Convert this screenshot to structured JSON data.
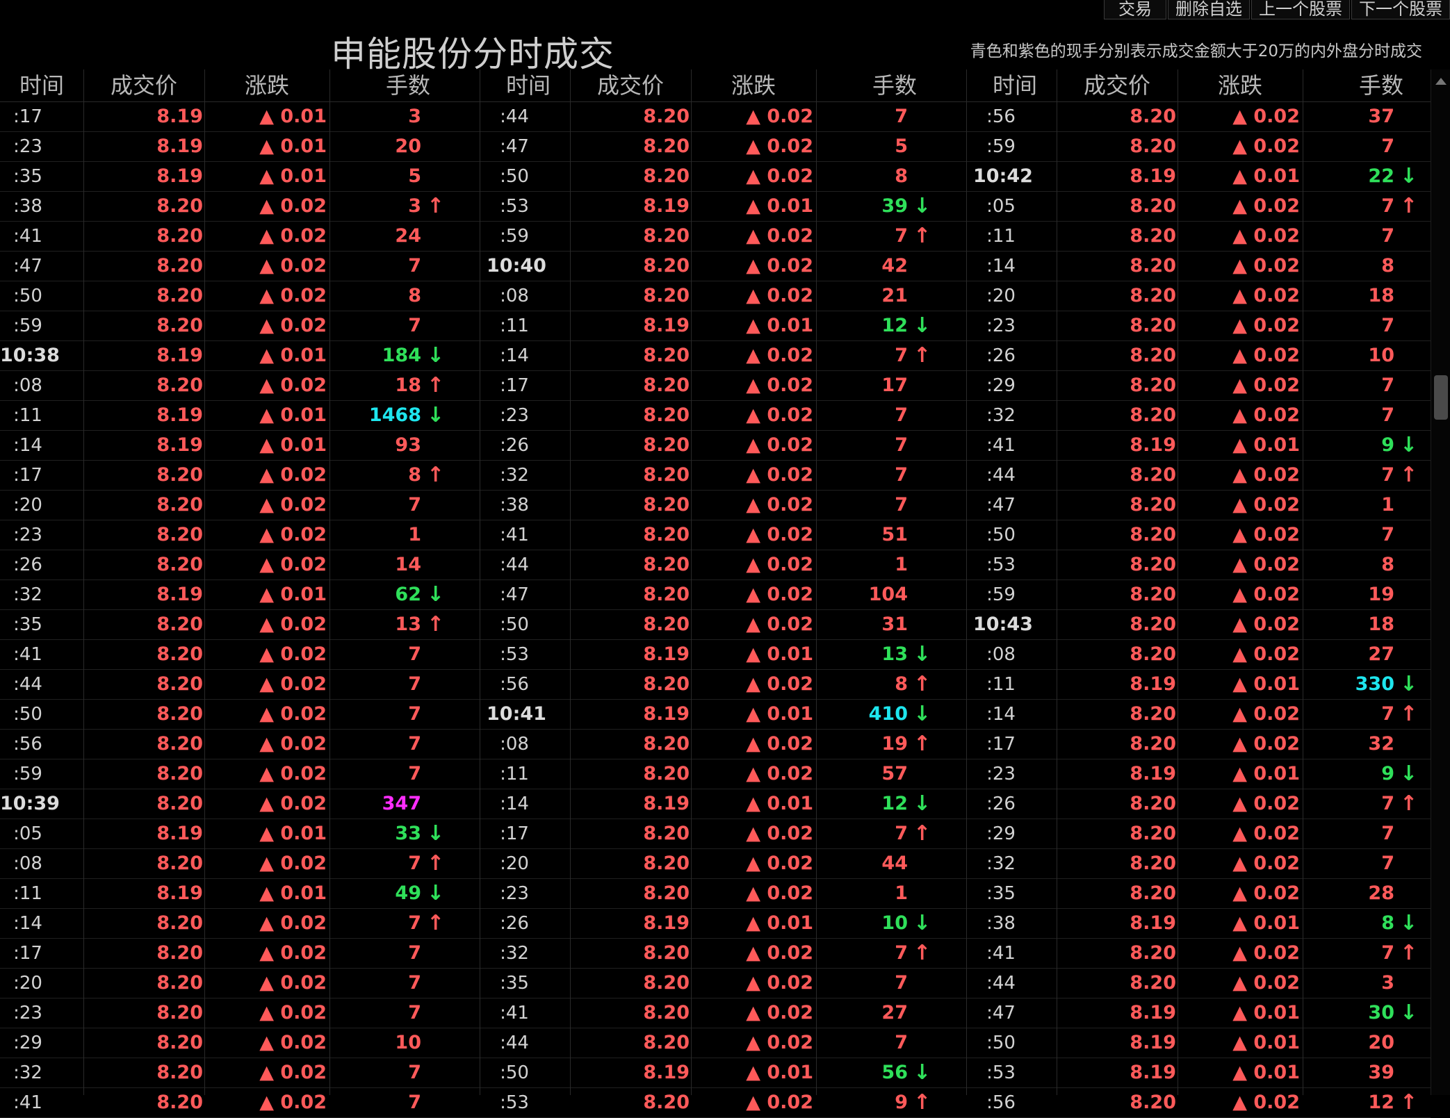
{
  "toolbar": {
    "buttons": [
      "交易",
      "删除自选",
      "上一个股票",
      "下一个股票"
    ]
  },
  "title": "申能股份分时成交",
  "note": "青色和紫色的现手分别表示成交金额大于20万的内外盘分时成交",
  "headers": [
    "时间",
    "成交价",
    "涨跌",
    "手数"
  ],
  "colors": {
    "up": "#ff5a5a",
    "down": "#2fe05a",
    "big_volume": "#1ee6ee",
    "big_volume_outer": "#ff2dff",
    "background": "#000000"
  },
  "columns": [
    {
      "rows": [
        {
          "time": ":17",
          "price": "8.19",
          "change": "▲ 0.01",
          "volume": "3",
          "arrow": ""
        },
        {
          "time": ":23",
          "price": "8.19",
          "change": "▲ 0.01",
          "volume": "20",
          "arrow": ""
        },
        {
          "time": ":35",
          "price": "8.19",
          "change": "▲ 0.01",
          "volume": "5",
          "arrow": ""
        },
        {
          "time": ":38",
          "price": "8.20",
          "change": "▲ 0.02",
          "volume": "3",
          "arrow": "up"
        },
        {
          "time": ":41",
          "price": "8.20",
          "change": "▲ 0.02",
          "volume": "24",
          "arrow": ""
        },
        {
          "time": ":47",
          "price": "8.20",
          "change": "▲ 0.02",
          "volume": "7",
          "arrow": ""
        },
        {
          "time": ":50",
          "price": "8.20",
          "change": "▲ 0.02",
          "volume": "8",
          "arrow": ""
        },
        {
          "time": ":59",
          "price": "8.20",
          "change": "▲ 0.02",
          "volume": "7",
          "arrow": ""
        },
        {
          "time": "10:38",
          "price": "8.19",
          "change": "▲ 0.01",
          "volume": "184",
          "arrow": "down"
        },
        {
          "time": ":08",
          "price": "8.20",
          "change": "▲ 0.02",
          "volume": "18",
          "arrow": "up"
        },
        {
          "time": ":11",
          "price": "8.19",
          "change": "▲ 0.01",
          "volume": "1468",
          "arrow": "down",
          "big": "cyan"
        },
        {
          "time": ":14",
          "price": "8.19",
          "change": "▲ 0.01",
          "volume": "93",
          "arrow": ""
        },
        {
          "time": ":17",
          "price": "8.20",
          "change": "▲ 0.02",
          "volume": "8",
          "arrow": "up"
        },
        {
          "time": ":20",
          "price": "8.20",
          "change": "▲ 0.02",
          "volume": "7",
          "arrow": ""
        },
        {
          "time": ":23",
          "price": "8.20",
          "change": "▲ 0.02",
          "volume": "1",
          "arrow": ""
        },
        {
          "time": ":26",
          "price": "8.20",
          "change": "▲ 0.02",
          "volume": "14",
          "arrow": ""
        },
        {
          "time": ":32",
          "price": "8.19",
          "change": "▲ 0.01",
          "volume": "62",
          "arrow": "down"
        },
        {
          "time": ":35",
          "price": "8.20",
          "change": "▲ 0.02",
          "volume": "13",
          "arrow": "up"
        },
        {
          "time": ":41",
          "price": "8.20",
          "change": "▲ 0.02",
          "volume": "7",
          "arrow": ""
        },
        {
          "time": ":44",
          "price": "8.20",
          "change": "▲ 0.02",
          "volume": "7",
          "arrow": ""
        },
        {
          "time": ":50",
          "price": "8.20",
          "change": "▲ 0.02",
          "volume": "7",
          "arrow": ""
        },
        {
          "time": ":56",
          "price": "8.20",
          "change": "▲ 0.02",
          "volume": "7",
          "arrow": ""
        },
        {
          "time": ":59",
          "price": "8.20",
          "change": "▲ 0.02",
          "volume": "7",
          "arrow": ""
        },
        {
          "time": "10:39",
          "price": "8.20",
          "change": "▲ 0.02",
          "volume": "347",
          "arrow": "",
          "big": "magenta"
        },
        {
          "time": ":05",
          "price": "8.19",
          "change": "▲ 0.01",
          "volume": "33",
          "arrow": "down"
        },
        {
          "time": ":08",
          "price": "8.20",
          "change": "▲ 0.02",
          "volume": "7",
          "arrow": "up"
        },
        {
          "time": ":11",
          "price": "8.19",
          "change": "▲ 0.01",
          "volume": "49",
          "arrow": "down"
        },
        {
          "time": ":14",
          "price": "8.20",
          "change": "▲ 0.02",
          "volume": "7",
          "arrow": "up"
        },
        {
          "time": ":17",
          "price": "8.20",
          "change": "▲ 0.02",
          "volume": "7",
          "arrow": ""
        },
        {
          "time": ":20",
          "price": "8.20",
          "change": "▲ 0.02",
          "volume": "7",
          "arrow": ""
        },
        {
          "time": ":23",
          "price": "8.20",
          "change": "▲ 0.02",
          "volume": "7",
          "arrow": ""
        },
        {
          "time": ":29",
          "price": "8.20",
          "change": "▲ 0.02",
          "volume": "10",
          "arrow": ""
        },
        {
          "time": ":32",
          "price": "8.20",
          "change": "▲ 0.02",
          "volume": "7",
          "arrow": ""
        },
        {
          "time": ":41",
          "price": "8.20",
          "change": "▲ 0.02",
          "volume": "7",
          "arrow": ""
        }
      ]
    },
    {
      "rows": [
        {
          "time": ":44",
          "price": "8.20",
          "change": "▲ 0.02",
          "volume": "7",
          "arrow": ""
        },
        {
          "time": ":47",
          "price": "8.20",
          "change": "▲ 0.02",
          "volume": "5",
          "arrow": ""
        },
        {
          "time": ":50",
          "price": "8.20",
          "change": "▲ 0.02",
          "volume": "8",
          "arrow": ""
        },
        {
          "time": ":53",
          "price": "8.19",
          "change": "▲ 0.01",
          "volume": "39",
          "arrow": "down"
        },
        {
          "time": ":59",
          "price": "8.20",
          "change": "▲ 0.02",
          "volume": "7",
          "arrow": "up"
        },
        {
          "time": "10:40",
          "price": "8.20",
          "change": "▲ 0.02",
          "volume": "42",
          "arrow": ""
        },
        {
          "time": ":08",
          "price": "8.20",
          "change": "▲ 0.02",
          "volume": "21",
          "arrow": ""
        },
        {
          "time": ":11",
          "price": "8.19",
          "change": "▲ 0.01",
          "volume": "12",
          "arrow": "down"
        },
        {
          "time": ":14",
          "price": "8.20",
          "change": "▲ 0.02",
          "volume": "7",
          "arrow": "up"
        },
        {
          "time": ":17",
          "price": "8.20",
          "change": "▲ 0.02",
          "volume": "17",
          "arrow": ""
        },
        {
          "time": ":23",
          "price": "8.20",
          "change": "▲ 0.02",
          "volume": "7",
          "arrow": ""
        },
        {
          "time": ":26",
          "price": "8.20",
          "change": "▲ 0.02",
          "volume": "7",
          "arrow": ""
        },
        {
          "time": ":32",
          "price": "8.20",
          "change": "▲ 0.02",
          "volume": "7",
          "arrow": ""
        },
        {
          "time": ":38",
          "price": "8.20",
          "change": "▲ 0.02",
          "volume": "7",
          "arrow": ""
        },
        {
          "time": ":41",
          "price": "8.20",
          "change": "▲ 0.02",
          "volume": "51",
          "arrow": ""
        },
        {
          "time": ":44",
          "price": "8.20",
          "change": "▲ 0.02",
          "volume": "1",
          "arrow": ""
        },
        {
          "time": ":47",
          "price": "8.20",
          "change": "▲ 0.02",
          "volume": "104",
          "arrow": ""
        },
        {
          "time": ":50",
          "price": "8.20",
          "change": "▲ 0.02",
          "volume": "31",
          "arrow": ""
        },
        {
          "time": ":53",
          "price": "8.19",
          "change": "▲ 0.01",
          "volume": "13",
          "arrow": "down"
        },
        {
          "time": ":56",
          "price": "8.20",
          "change": "▲ 0.02",
          "volume": "8",
          "arrow": "up"
        },
        {
          "time": "10:41",
          "price": "8.19",
          "change": "▲ 0.01",
          "volume": "410",
          "arrow": "down",
          "big": "cyan"
        },
        {
          "time": ":08",
          "price": "8.20",
          "change": "▲ 0.02",
          "volume": "19",
          "arrow": "up"
        },
        {
          "time": ":11",
          "price": "8.20",
          "change": "▲ 0.02",
          "volume": "57",
          "arrow": ""
        },
        {
          "time": ":14",
          "price": "8.19",
          "change": "▲ 0.01",
          "volume": "12",
          "arrow": "down"
        },
        {
          "time": ":17",
          "price": "8.20",
          "change": "▲ 0.02",
          "volume": "7",
          "arrow": "up"
        },
        {
          "time": ":20",
          "price": "8.20",
          "change": "▲ 0.02",
          "volume": "44",
          "arrow": ""
        },
        {
          "time": ":23",
          "price": "8.20",
          "change": "▲ 0.02",
          "volume": "1",
          "arrow": ""
        },
        {
          "time": ":26",
          "price": "8.19",
          "change": "▲ 0.01",
          "volume": "10",
          "arrow": "down"
        },
        {
          "time": ":32",
          "price": "8.20",
          "change": "▲ 0.02",
          "volume": "7",
          "arrow": "up"
        },
        {
          "time": ":35",
          "price": "8.20",
          "change": "▲ 0.02",
          "volume": "7",
          "arrow": ""
        },
        {
          "time": ":41",
          "price": "8.20",
          "change": "▲ 0.02",
          "volume": "27",
          "arrow": ""
        },
        {
          "time": ":44",
          "price": "8.20",
          "change": "▲ 0.02",
          "volume": "7",
          "arrow": ""
        },
        {
          "time": ":50",
          "price": "8.19",
          "change": "▲ 0.01",
          "volume": "56",
          "arrow": "down"
        },
        {
          "time": ":53",
          "price": "8.20",
          "change": "▲ 0.02",
          "volume": "9",
          "arrow": "up"
        }
      ]
    },
    {
      "rows": [
        {
          "time": ":56",
          "price": "8.20",
          "change": "▲ 0.02",
          "volume": "37",
          "arrow": ""
        },
        {
          "time": ":59",
          "price": "8.20",
          "change": "▲ 0.02",
          "volume": "7",
          "arrow": ""
        },
        {
          "time": "10:42",
          "price": "8.19",
          "change": "▲ 0.01",
          "volume": "22",
          "arrow": "down"
        },
        {
          "time": ":05",
          "price": "8.20",
          "change": "▲ 0.02",
          "volume": "7",
          "arrow": "up"
        },
        {
          "time": ":11",
          "price": "8.20",
          "change": "▲ 0.02",
          "volume": "7",
          "arrow": ""
        },
        {
          "time": ":14",
          "price": "8.20",
          "change": "▲ 0.02",
          "volume": "8",
          "arrow": ""
        },
        {
          "time": ":20",
          "price": "8.20",
          "change": "▲ 0.02",
          "volume": "18",
          "arrow": ""
        },
        {
          "time": ":23",
          "price": "8.20",
          "change": "▲ 0.02",
          "volume": "7",
          "arrow": ""
        },
        {
          "time": ":26",
          "price": "8.20",
          "change": "▲ 0.02",
          "volume": "10",
          "arrow": ""
        },
        {
          "time": ":29",
          "price": "8.20",
          "change": "▲ 0.02",
          "volume": "7",
          "arrow": ""
        },
        {
          "time": ":32",
          "price": "8.20",
          "change": "▲ 0.02",
          "volume": "7",
          "arrow": ""
        },
        {
          "time": ":41",
          "price": "8.19",
          "change": "▲ 0.01",
          "volume": "9",
          "arrow": "down"
        },
        {
          "time": ":44",
          "price": "8.20",
          "change": "▲ 0.02",
          "volume": "7",
          "arrow": "up"
        },
        {
          "time": ":47",
          "price": "8.20",
          "change": "▲ 0.02",
          "volume": "1",
          "arrow": ""
        },
        {
          "time": ":50",
          "price": "8.20",
          "change": "▲ 0.02",
          "volume": "7",
          "arrow": ""
        },
        {
          "time": ":53",
          "price": "8.20",
          "change": "▲ 0.02",
          "volume": "8",
          "arrow": ""
        },
        {
          "time": ":59",
          "price": "8.20",
          "change": "▲ 0.02",
          "volume": "19",
          "arrow": ""
        },
        {
          "time": "10:43",
          "price": "8.20",
          "change": "▲ 0.02",
          "volume": "18",
          "arrow": ""
        },
        {
          "time": ":08",
          "price": "8.20",
          "change": "▲ 0.02",
          "volume": "27",
          "arrow": ""
        },
        {
          "time": ":11",
          "price": "8.19",
          "change": "▲ 0.01",
          "volume": "330",
          "arrow": "down",
          "big": "cyan"
        },
        {
          "time": ":14",
          "price": "8.20",
          "change": "▲ 0.02",
          "volume": "7",
          "arrow": "up"
        },
        {
          "time": ":17",
          "price": "8.20",
          "change": "▲ 0.02",
          "volume": "32",
          "arrow": ""
        },
        {
          "time": ":23",
          "price": "8.19",
          "change": "▲ 0.01",
          "volume": "9",
          "arrow": "down"
        },
        {
          "time": ":26",
          "price": "8.20",
          "change": "▲ 0.02",
          "volume": "7",
          "arrow": "up"
        },
        {
          "time": ":29",
          "price": "8.20",
          "change": "▲ 0.02",
          "volume": "7",
          "arrow": ""
        },
        {
          "time": ":32",
          "price": "8.20",
          "change": "▲ 0.02",
          "volume": "7",
          "arrow": ""
        },
        {
          "time": ":35",
          "price": "8.20",
          "change": "▲ 0.02",
          "volume": "28",
          "arrow": ""
        },
        {
          "time": ":38",
          "price": "8.19",
          "change": "▲ 0.01",
          "volume": "8",
          "arrow": "down"
        },
        {
          "time": ":41",
          "price": "8.20",
          "change": "▲ 0.02",
          "volume": "7",
          "arrow": "up"
        },
        {
          "time": ":44",
          "price": "8.20",
          "change": "▲ 0.02",
          "volume": "3",
          "arrow": ""
        },
        {
          "time": ":47",
          "price": "8.19",
          "change": "▲ 0.01",
          "volume": "30",
          "arrow": "down"
        },
        {
          "time": ":50",
          "price": "8.19",
          "change": "▲ 0.01",
          "volume": "20",
          "arrow": ""
        },
        {
          "time": ":53",
          "price": "8.19",
          "change": "▲ 0.01",
          "volume": "39",
          "arrow": ""
        },
        {
          "time": ":56",
          "price": "8.20",
          "change": "▲ 0.02",
          "volume": "12",
          "arrow": "up"
        }
      ]
    }
  ]
}
